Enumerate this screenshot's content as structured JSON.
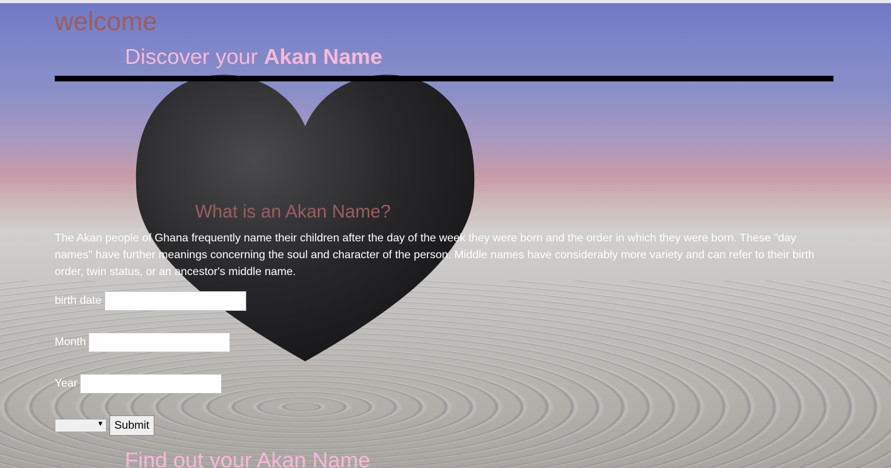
{
  "header": {
    "welcome": "welcome",
    "discover_prefix": "Discover your ",
    "discover_bold": "Akan Name"
  },
  "intro": {
    "heading": "What is an Akan Name?",
    "text": "The Akan people of Ghana frequently name their children after the day of the week they were born and the order in which they were born. These \"day names\" have further meanings concerning the soul and character of the person. Middle names have considerably more variety and can refer to their birth order, twin status, or an ancestor's middle name."
  },
  "form": {
    "birth_date_label": "birth date",
    "birth_date_value": "",
    "month_label": "Month",
    "month_value": "",
    "year_label": "Year",
    "year_value": "",
    "gender_select_value": "",
    "submit_label": "Submit"
  },
  "footer": {
    "find_out": "Find out your Akan Name"
  },
  "colors": {
    "welcome": "#9b5e5e",
    "pink_heading": "#f8b8d8",
    "rule": "#000000",
    "body_text": "#ffffff"
  }
}
